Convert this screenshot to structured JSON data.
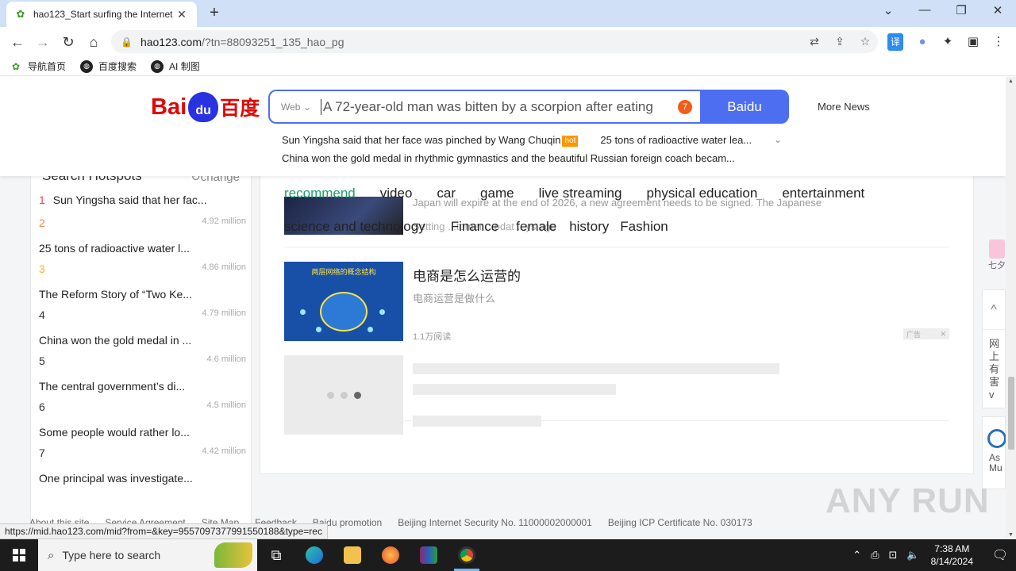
{
  "browser": {
    "tab_title": "hao123_Start surfing the Internet",
    "tab_close": "✕",
    "new_tab": "+",
    "url_main": "hao123.com",
    "url_rest": "/?tn=88093251_135_hao_pg",
    "bookmarks": [
      {
        "label": "导航首页",
        "icon": "hao-icon"
      },
      {
        "label": "百度搜索",
        "icon": "globe-icon"
      },
      {
        "label": "AI 制图",
        "icon": "globe-icon"
      }
    ]
  },
  "header": {
    "logo_bai": "Bai",
    "logo_paw": "du",
    "logo_du": "百度",
    "search_scope": "Web",
    "search_value": "A 72-year-old man was bitten by a scorpion after eating",
    "search_badge": "7",
    "search_button": "Baidu",
    "more_news": "More News",
    "hot_row1_a": "Sun Yingsha said that her face was pinched by Wang Chuqin",
    "hot_tag": "hot",
    "hot_row1_b": "25 tons of radioactive water lea...",
    "hot_row2": "China won the gold medal in rhythmic gymnastics and the beautiful Russian foreign coach becam..."
  },
  "left_panel": {
    "title": "Search Hotspots",
    "change": "change",
    "items": [
      {
        "rank": "1",
        "title": "Sun Yingsha said that her fac...",
        "count": ""
      },
      {
        "rank": "2",
        "title": "25 tons of radioactive water l...",
        "count": "4.92 million"
      },
      {
        "rank": "3",
        "title": "The Reform Story of “Two Ke...",
        "count": "4.86 million"
      },
      {
        "rank": "4",
        "title": "China won the gold medal in ...",
        "count": "4.79 million"
      },
      {
        "rank": "5",
        "title": "The central government’s di...",
        "count": "4.6 million"
      },
      {
        "rank": "6",
        "title": "Some people would rather lo...",
        "count": "4.5 million"
      },
      {
        "rank": "7",
        "title": "One principal was investigate...",
        "count": "4.42 million"
      }
    ],
    "rank_colors": [
      "#f54545",
      "#ff8547",
      "#ffac38"
    ]
  },
  "feed": {
    "tabs": [
      "recommend",
      "video",
      "car",
      "game",
      "live streaming",
      "physical education",
      "entertainment"
    ],
    "tabs_row2": [
      "science and technology",
      "Finance",
      "female",
      "history",
      "Fashion"
    ],
    "news1_text": "Japan will expire at the end of 2026, a new agreement needs to be signed. The Japanese",
    "news1_meta": "Setting   ...tomer   ...pdat   ...ys ago",
    "news2_caption": "两层网络的概念结构",
    "news2_title": "电商是怎么运营的",
    "news2_sub": "电商运营是做什么",
    "news2_read": "1.1万阅读",
    "ad_label": "广告",
    "ad_close": "✕"
  },
  "right_float": {
    "gift_label": "七夕",
    "up_arrow": "^",
    "side_text": "网上有害",
    "chevron": "v",
    "side2_text": "As Mu"
  },
  "footer": {
    "links": [
      "About this site",
      "Service Agreement",
      "Site Map",
      "Feedback",
      "Baidu promotion",
      "Beijing Internet Security No. 11000002000001",
      "Beijing ICP Certificate No. 030173"
    ],
    "status_url": "https://mid.hao123.com/mid?from=&key=9557097377991550188&type=rec",
    "watermark": "ANY RUN"
  },
  "taskbar": {
    "search_placeholder": "Type here to search",
    "time": "7:38 AM",
    "date": "8/14/2024"
  },
  "colors": {
    "accent": "#4e6ef2",
    "tab_active": "#1aa06d",
    "baidu_red": "#e10602"
  }
}
